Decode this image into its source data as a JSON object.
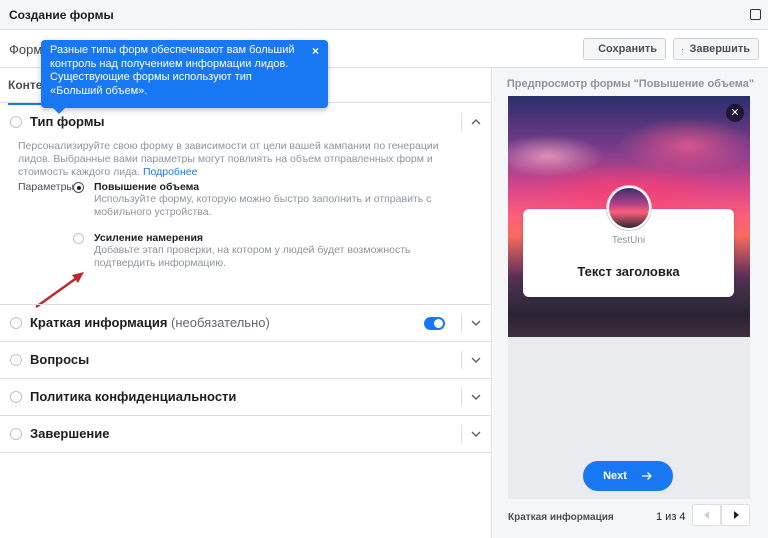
{
  "window": {
    "title": "Создание формы"
  },
  "toolbar": {
    "form_name": "Форм",
    "save_label": "Сохранить",
    "finish_label": "Завершить"
  },
  "tabs": {
    "active": "Контент"
  },
  "tooltip": {
    "text": "Разные типы форм обеспечивают вам больший контроль над получением информации лидов. Существующие формы используют тип «Больший объем».",
    "close": "×"
  },
  "form_type": {
    "title": "Тип формы",
    "description": "Персонализируйте свою форму в зависимости от цели вашей кампании по генерации лидов. Выбранные вами параметры могут повлиять на объем отправленных форм и стоимость каждого лида.",
    "learn_more": "Подробнее",
    "params_label": "Параметры",
    "options": [
      {
        "title": "Повышение объема",
        "description": "Используйте форму, которую можно быстро заполнить и отправить с мобильного устройства.",
        "selected": true
      },
      {
        "title": "Усиление намерения",
        "description": "Добавьте этап проверки, на котором у людей будет возможность подтвердить информацию.",
        "selected": false
      }
    ]
  },
  "sections": [
    {
      "title": "Краткая информация",
      "optional": "(необязательно)",
      "toggle_on": true
    },
    {
      "title": "Вопросы"
    },
    {
      "title": "Политика конфиденциальности"
    },
    {
      "title": "Завершение"
    }
  ],
  "preview": {
    "title": "Предпросмотр формы \"Повышение объема\"",
    "page_name": "TestUni",
    "headline": "Текст заголовка",
    "next_label": "Next",
    "footer_label": "Краткая информация",
    "pager": "1 из 4"
  },
  "colors": {
    "accent": "#1877f2",
    "arrow": "#c0282a"
  }
}
